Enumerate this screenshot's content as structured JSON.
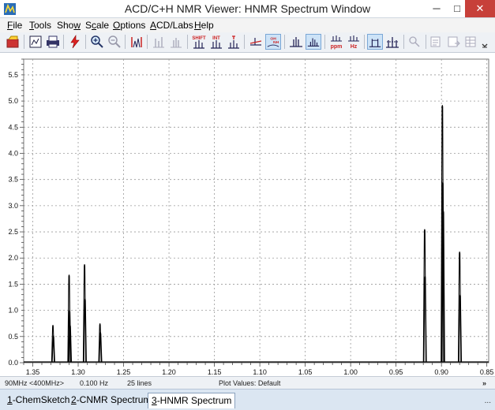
{
  "window": {
    "title": "ACD/C+H NMR Viewer: HNMR Spectrum Window",
    "minimize_glyph": "─",
    "maximize_glyph": "□",
    "close_glyph": "✕"
  },
  "menu": [
    {
      "key": "F",
      "rest": "ile"
    },
    {
      "key": "T",
      "rest": "ools"
    },
    {
      "pre": "Sho",
      "key": "w",
      "rest": ""
    },
    {
      "pre": "S",
      "key": "c",
      "rest": "ale"
    },
    {
      "key": "O",
      "rest": "ptions"
    },
    {
      "key": "A",
      "pre": "",
      "rest": "CD/Labs",
      "full_pre": ""
    },
    {
      "key": "H",
      "rest": "elp"
    }
  ],
  "toolbar": {
    "shift_label": "SHIFT",
    "int_label": "INT",
    "ppm_label": "ppm",
    "hz_label": "Hz",
    "icons": [
      "open-icon",
      "print-preview-icon",
      "print-icon",
      "lightning-icon",
      "zoom-in-icon",
      "zoom-out-icon",
      "full-spectrum-icon",
      "expand-icon",
      "shift-icon",
      "integral-icon",
      "peak-label-icon",
      "baseline-icon",
      "oh-nh-icon",
      "peaks-icon",
      "multiplet-icon",
      "ppm-icon",
      "hz-icon",
      "cursor-icon",
      "multi-cursor-icon",
      "assign-icon",
      "report-icon",
      "export-icon",
      "more-icon"
    ]
  },
  "chart_data": {
    "type": "line",
    "title": "",
    "xlabel": "",
    "ylabel": "",
    "xlim": [
      1.36,
      0.848
    ],
    "ylim": [
      0,
      5.8
    ],
    "x_ticks": [
      "1.35",
      "1.30",
      "1.25",
      "1.20",
      "1.15",
      "1.10",
      "1.05",
      "1.00",
      "0.95",
      "0.90",
      "0.85"
    ],
    "x_tick_values": [
      1.35,
      1.3,
      1.25,
      1.2,
      1.15,
      1.1,
      1.05,
      1.0,
      0.95,
      0.9,
      0.85
    ],
    "y_ticks": [
      "0.0",
      "0.5",
      "1.0",
      "1.5",
      "2.0",
      "2.5",
      "3.0",
      "3.5",
      "4.0",
      "4.5",
      "5.0",
      "5.5"
    ],
    "y_tick_values": [
      0,
      0.5,
      1.0,
      1.5,
      2.0,
      2.5,
      3.0,
      3.5,
      4.0,
      4.5,
      5.0,
      5.5
    ],
    "grid": true,
    "peaks": [
      {
        "x": 1.3278,
        "y": 0.72
      },
      {
        "x": 1.3272,
        "y": 0.52
      },
      {
        "x": 1.31,
        "y": 1.68
      },
      {
        "x": 1.3094,
        "y": 1.0
      },
      {
        "x": 1.3088,
        "y": 0.72
      },
      {
        "x": 1.293,
        "y": 1.88
      },
      {
        "x": 1.2924,
        "y": 1.22
      },
      {
        "x": 1.276,
        "y": 0.75
      },
      {
        "x": 1.2754,
        "y": 0.58
      },
      {
        "x": 0.9185,
        "y": 2.55
      },
      {
        "x": 0.918,
        "y": 1.65
      },
      {
        "x": 0.899,
        "y": 4.92
      },
      {
        "x": 0.8985,
        "y": 3.45
      },
      {
        "x": 0.8979,
        "y": 2.9
      },
      {
        "x": 0.88,
        "y": 2.12
      },
      {
        "x": 0.8794,
        "y": 1.3
      }
    ]
  },
  "status": {
    "frequency": "90MHz <400MHz>",
    "resolution": "0.100 Hz",
    "lines": "25 lines",
    "plot_values": "Plot Values: Default",
    "more": "»"
  },
  "tabs": [
    {
      "key": "1",
      "label": "-ChemSketch",
      "selected": false
    },
    {
      "key": "2",
      "label": "-CNMR Spectrum",
      "selected": false
    },
    {
      "key": "3",
      "label": "-HNMR Spectrum",
      "selected": true
    }
  ],
  "tabs_more": "..."
}
